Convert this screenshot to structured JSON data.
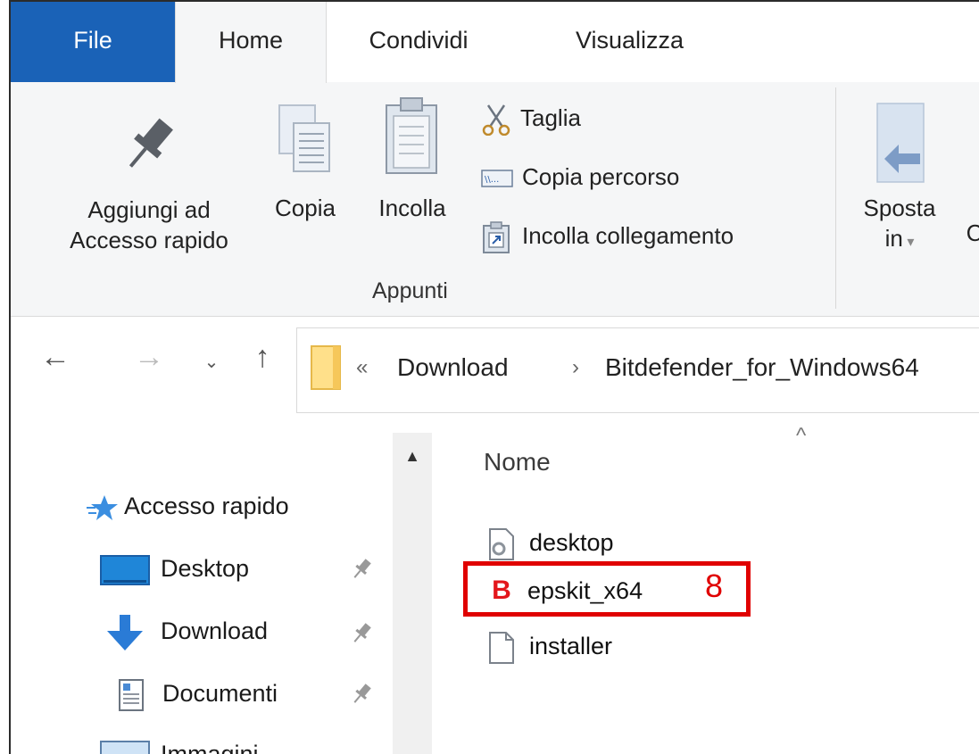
{
  "tabs": {
    "file": "File",
    "home": "Home",
    "share": "Condividi",
    "view": "Visualizza"
  },
  "ribbon": {
    "pin_label_1": "Aggiungi ad",
    "pin_label_2": "Accesso rapido",
    "copy_label": "Copia",
    "paste_label": "Incolla",
    "cut_label": "Taglia",
    "copy_path_label": "Copia percorso",
    "paste_shortcut_label": "Incolla collegamento",
    "group_clipboard": "Appunti",
    "move_label_1": "Sposta",
    "move_label_2": "in",
    "next_partial": "C"
  },
  "address": {
    "overflow": "«",
    "crumbs": [
      "Download",
      "Bitdefender_for_Windows64"
    ]
  },
  "nav_pane": {
    "items": [
      {
        "label": "Accesso rapido",
        "icon": "star-icon"
      },
      {
        "label": "Desktop",
        "icon": "desktop-folder-icon"
      },
      {
        "label": "Download",
        "icon": "download-arrow-icon"
      },
      {
        "label": "Documenti",
        "icon": "document-icon"
      },
      {
        "label": "Immagini",
        "icon": "pictures-icon"
      }
    ]
  },
  "content": {
    "column_name": "Nome",
    "files": [
      {
        "name": "desktop",
        "icon": "settings-file-icon"
      },
      {
        "name": "epskit_x64",
        "icon": "bitdefender-b-icon"
      },
      {
        "name": "installer",
        "icon": "blank-file-icon"
      }
    ]
  },
  "annotation": {
    "step": "8",
    "color": "#e00000"
  },
  "colors": {
    "file_tab": "#1a62b7",
    "ribbon_bg": "#f5f6f7",
    "bitdefender_red": "#e3161b"
  }
}
